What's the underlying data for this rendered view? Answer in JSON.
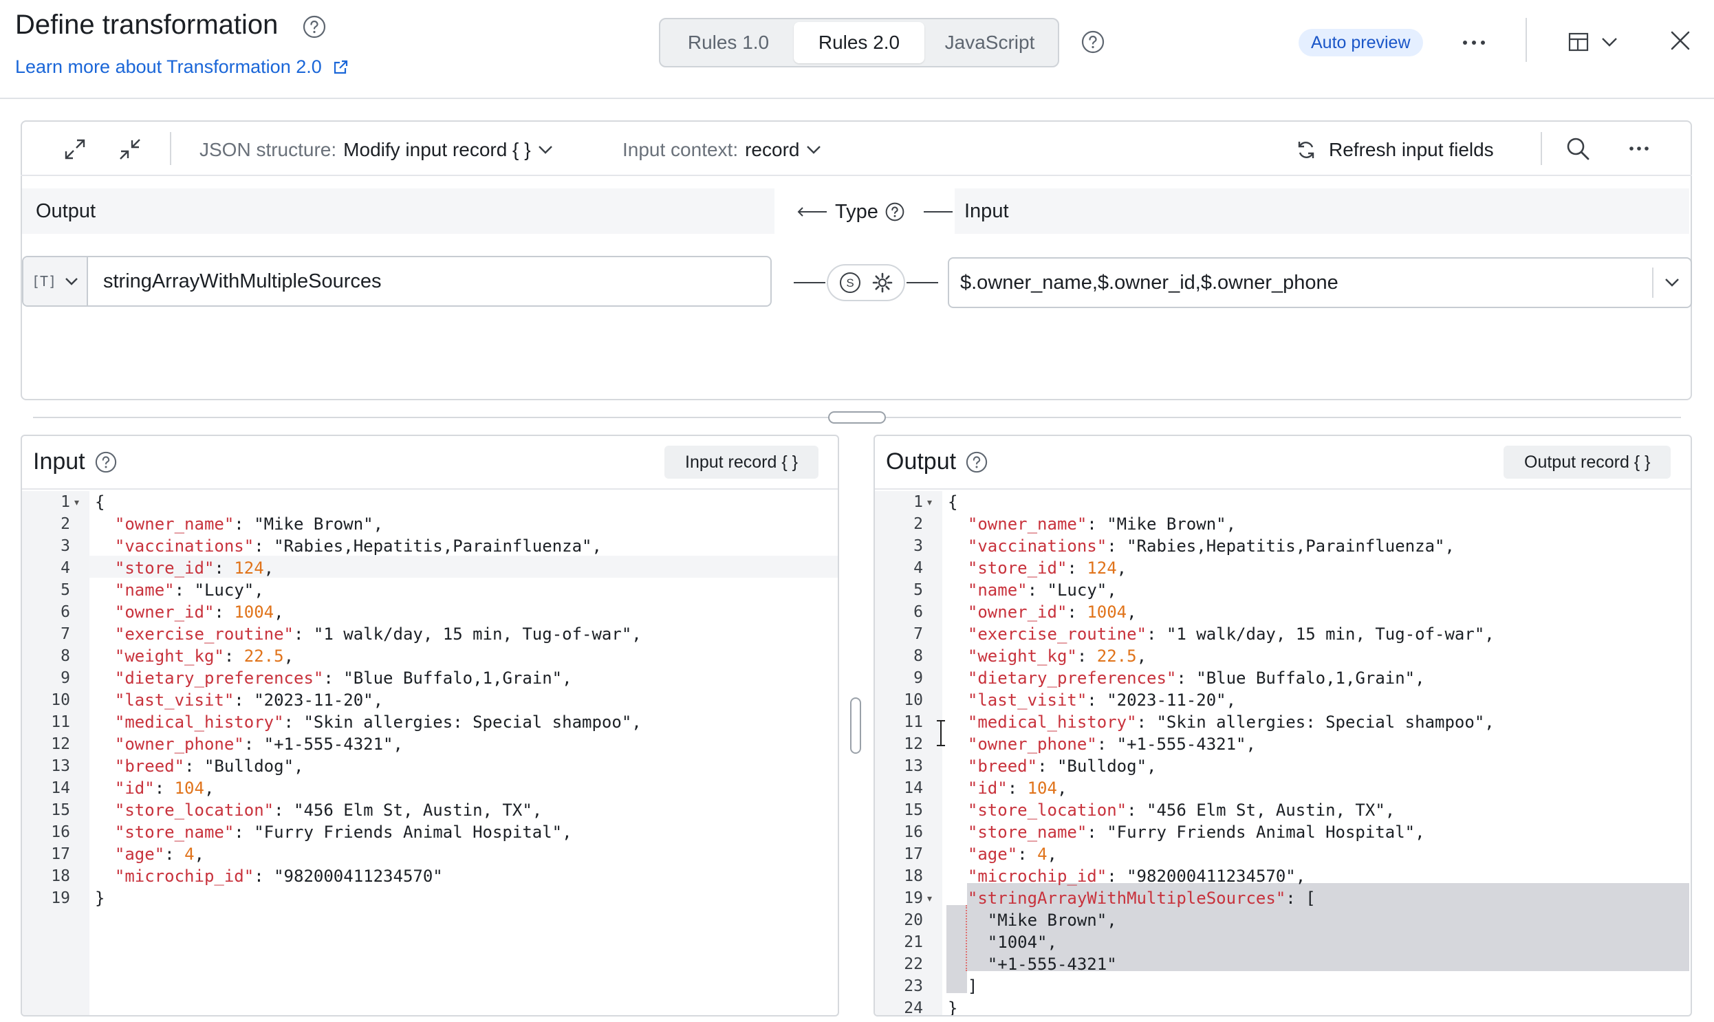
{
  "header": {
    "title": "Define transformation",
    "learn_more": "Learn more about Transformation 2.0",
    "modes": [
      "Rules 1.0",
      "Rules 2.0",
      "JavaScript"
    ],
    "active_mode": "Rules 2.0",
    "auto_preview": "Auto preview"
  },
  "toolbar": {
    "json_structure_label": "JSON structure:",
    "json_structure_value": "Modify input record { }",
    "input_context_label": "Input context:",
    "input_context_value": "record",
    "refresh_label": "Refresh input fields"
  },
  "mapping": {
    "output_header": "Output",
    "type_header": "Type",
    "input_header": "Input",
    "type_badge": "[T]",
    "output_field": "stringArrayWithMultipleSources",
    "input_field": "$.owner_name,$.owner_id,$.owner_phone"
  },
  "input_pane": {
    "title": "Input",
    "record_button": "Input record { }",
    "lines": [
      "{",
      "  \"owner_name\": \"Mike Brown\",",
      "  \"vaccinations\": \"Rabies,Hepatitis,Parainfluenza\",",
      "  \"store_id\": 124,",
      "  \"name\": \"Lucy\",",
      "  \"owner_id\": 1004,",
      "  \"exercise_routine\": \"1 walk/day, 15 min, Tug-of-war\",",
      "  \"weight_kg\": 22.5,",
      "  \"dietary_preferences\": \"Blue Buffalo,1,Grain\",",
      "  \"last_visit\": \"2023-11-20\",",
      "  \"medical_history\": \"Skin allergies: Special shampoo\",",
      "  \"owner_phone\": \"+1-555-4321\",",
      "  \"breed\": \"Bulldog\",",
      "  \"id\": 104,",
      "  \"store_location\": \"456 Elm St, Austin, TX\",",
      "  \"store_name\": \"Furry Friends Animal Hospital\",",
      "  \"age\": 4,",
      "  \"microchip_id\": \"982000411234570\"",
      "}"
    ]
  },
  "output_pane": {
    "title": "Output",
    "record_button": "Output record { }",
    "lines": [
      "{",
      "  \"owner_name\": \"Mike Brown\",",
      "  \"vaccinations\": \"Rabies,Hepatitis,Parainfluenza\",",
      "  \"store_id\": 124,",
      "  \"name\": \"Lucy\",",
      "  \"owner_id\": 1004,",
      "  \"exercise_routine\": \"1 walk/day, 15 min, Tug-of-war\",",
      "  \"weight_kg\": 22.5,",
      "  \"dietary_preferences\": \"Blue Buffalo,1,Grain\",",
      "  \"last_visit\": \"2023-11-20\",",
      "  \"medical_history\": \"Skin allergies: Special shampoo\",",
      "  \"owner_phone\": \"+1-555-4321\",",
      "  \"breed\": \"Bulldog\",",
      "  \"id\": 104,",
      "  \"store_location\": \"456 Elm St, Austin, TX\",",
      "  \"store_name\": \"Furry Friends Animal Hospital\",",
      "  \"age\": 4,",
      "  \"microchip_id\": \"982000411234570\",",
      "  \"stringArrayWithMultipleSources\": [",
      "    \"Mike Brown\",",
      "    \"1004\",",
      "    \"+1-555-4321\"",
      "  ]",
      "}"
    ]
  },
  "colors": {
    "accent": "#1a66d8",
    "json_key": "#c8323c",
    "json_number": "#e0731a",
    "highlight": "#d6d7dc"
  }
}
